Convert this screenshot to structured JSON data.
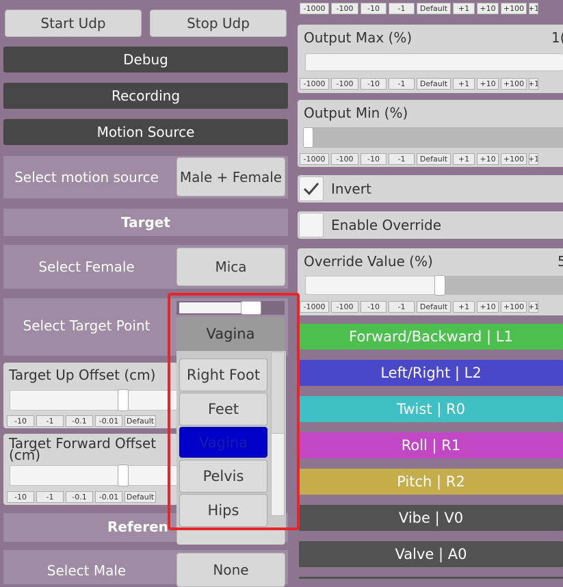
{
  "udp": {
    "start_label": "Start Udp",
    "stop_label": "Stop Udp"
  },
  "sections": {
    "debug": "Debug",
    "recording": "Recording",
    "motion_source": "Motion Source"
  },
  "motion_source": {
    "label": "Select motion source",
    "value": "Male + Female"
  },
  "target": {
    "header": "Target",
    "female_label": "Select Female",
    "female_value": "Mica",
    "point_label": "Select Target Point",
    "point_value": "Vagina",
    "up_offset_label": "Target Up Offset (cm)",
    "forward_offset_label": "Target Forward Offset (cm)"
  },
  "reference": {
    "header": "Referen",
    "male_label": "Select Male",
    "male_value": "None"
  },
  "left_steps": [
    "-10",
    "-1",
    "-0.1",
    "-0.01",
    "Default"
  ],
  "right_steps": [
    "-1000",
    "-100",
    "-10",
    "-1",
    "Default",
    "+1",
    "+10",
    "+100",
    "+1"
  ],
  "output_max": {
    "label": "Output Max (%)",
    "value_partial": "1("
  },
  "output_min": {
    "label": "Output Min (%)"
  },
  "invert": {
    "label": "Invert",
    "checked": true
  },
  "override": {
    "enable_label": "Enable Override",
    "value_label": "Override Value (%)",
    "value_partial": "5"
  },
  "dropdown": {
    "slider_level": 0.7,
    "selected": "Vagina",
    "options": [
      "Right Foot",
      "Feet",
      "Vagina",
      "Pelvis",
      "Hips"
    ],
    "highlight_color": "#0000c8",
    "frame_color": "#e8262a"
  },
  "axes": [
    {
      "label": "Forward/Backward | L1",
      "color": "#4cbf4f"
    },
    {
      "label": "Left/Right | L2",
      "color": "#4a47c9"
    },
    {
      "label": "Twist | R0",
      "color": "#3fc0c4"
    },
    {
      "label": "Roll | R1",
      "color": "#c147c4"
    },
    {
      "label": "Pitch | R2",
      "color": "#c4ad4a"
    },
    {
      "label": "Vibe | V0",
      "color": "#525252"
    },
    {
      "label": "Valve | A0",
      "color": "#525252"
    }
  ]
}
